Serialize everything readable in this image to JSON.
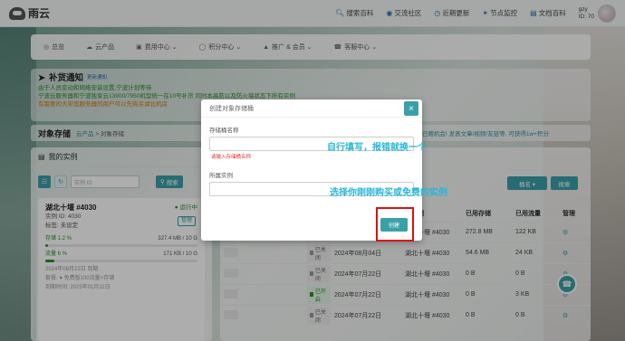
{
  "topbar": {
    "brand": "雨云",
    "nav": [
      {
        "label": "搜索百科",
        "icon": "search-icon"
      },
      {
        "label": "交流社区",
        "icon": "chat-icon"
      },
      {
        "label": "近期更新",
        "icon": "history-icon"
      },
      {
        "label": "节点监控",
        "icon": "monitor-icon"
      },
      {
        "label": "文档百科",
        "icon": "book-icon"
      }
    ],
    "user": {
      "name": "gzy",
      "id_label": "ID: 70"
    }
  },
  "mainnav": [
    {
      "label": "总览",
      "icon": "globe-icon"
    },
    {
      "label": "云产品",
      "icon": "cloud-icon"
    },
    {
      "label": "费用中心 ⌄",
      "icon": "wallet-icon"
    },
    {
      "label": "积分中心 ⌄",
      "icon": "coin-icon"
    },
    {
      "label": "推广 & 会员 ⌄",
      "icon": "promo-icon"
    },
    {
      "label": "客服中心 ⌄",
      "icon": "support-icon"
    }
  ],
  "notice": {
    "title": "补货通知",
    "subtitle": "更新通知",
    "line1": "由于人员变动和网络安装设置,宁波计划等待",
    "line2": "宁波云服务器和宁波独享云13900/7950机型统一在10号补货 同时本高防以及防火墙状态下所有实例",
    "line3": "有需要的大带宽服务器的用户可以先购买湖北机房"
  },
  "breadcrumb": {
    "title": "对象存储",
    "items": [
      "云产品",
      "对象存储"
    ]
  },
  "promo_text": "【活动】已赠机会! 发表文章/视频/友链等, 可获得1w+积分",
  "left": {
    "header": "我的实例",
    "search_placeholder": "实例 ID",
    "search_button": "搜索",
    "card": {
      "name": "湖北十堰 #4030",
      "status": "运行中",
      "id_line": "实例 ID: 4030",
      "tag_line": "标签: 未设定",
      "manage": "管理",
      "storage_label": "存储 1.2 %",
      "storage_value": "327.4 MB / 10 G",
      "storage_pct": 1.2,
      "traffic_label": "流量 6 %",
      "traffic_value": "171 KB / 10 G",
      "traffic_pct": 6,
      "created": "2024年08月22日 到期",
      "plan": "套餐: ♥ 免费版100流量+存储",
      "expire": "到期时间: 2025年01月11日"
    }
  },
  "right": {
    "btn_name": "桶名 ▾",
    "btn_search": "搜索",
    "columns": [
      "",
      "",
      "",
      "属实例",
      "已用存储",
      "已用流量",
      "管理"
    ],
    "rows": [
      {
        "status": "已关闭",
        "date": "2024年08月04日",
        "instance": "湖北十堰 #4030",
        "storage": "272.8 MB",
        "traffic": "122 KB",
        "on": false
      },
      {
        "status": "已关闭",
        "date": "2024年08月04日",
        "instance": "湖北十堰 #4030",
        "storage": "54.6 MB",
        "traffic": "24 KB",
        "on": false
      },
      {
        "status": "已关闭",
        "date": "2024年07月22日",
        "instance": "湖北十堰 #4030",
        "storage": "0 B",
        "traffic": "0 B",
        "on": false
      },
      {
        "status": "已开启",
        "date": "2024年07月22日",
        "instance": "湖北十堰 #4030",
        "storage": "0 B",
        "traffic": "3 KB",
        "on": true
      },
      {
        "status": "已关闭",
        "date": "2024年07月22日",
        "instance": "湖北十堰 #4030",
        "storage": "0 B",
        "traffic": "0 B",
        "on": false
      }
    ]
  },
  "modal": {
    "title": "创建对象存储桶",
    "name_label": "存储桶名称",
    "name_error": "请输入存储桶名称",
    "instance_label": "所属实例",
    "create_button": "创建",
    "close": "×"
  },
  "annotations": {
    "a1": "自行填写，报错就换一个",
    "a2": "选择你刚刚购买或免费的实例"
  }
}
